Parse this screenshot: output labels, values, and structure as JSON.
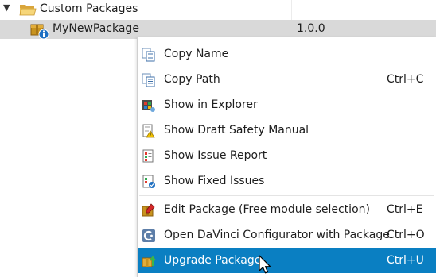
{
  "tree": {
    "parent": {
      "label": "Custom Packages",
      "expanded": true
    },
    "child": {
      "label": "MyNewPackage",
      "version": "1.0.0"
    }
  },
  "context_menu": {
    "items": [
      {
        "label": "Copy Name",
        "shortcut": "",
        "icon": "copy-name-icon"
      },
      {
        "label": "Copy Path",
        "shortcut": "Ctrl+C",
        "icon": "copy-path-icon"
      },
      {
        "label": "Show in Explorer",
        "shortcut": "",
        "icon": "explorer-icon"
      },
      {
        "label": "Show Draft Safety Manual",
        "shortcut": "",
        "icon": "safety-manual-icon"
      },
      {
        "label": "Show Issue Report",
        "shortcut": "",
        "icon": "issue-report-icon"
      },
      {
        "label": "Show Fixed Issues",
        "shortcut": "",
        "icon": "fixed-issues-icon"
      },
      {
        "label": "Edit Package (Free module selection)",
        "shortcut": "Ctrl+E",
        "icon": "edit-package-icon"
      },
      {
        "label": "Open DaVinci Configurator with Package",
        "shortcut": "Ctrl+O",
        "icon": "davinci-configurator-icon"
      },
      {
        "label": "Upgrade Package",
        "shortcut": "Ctrl+U",
        "icon": "upgrade-package-icon",
        "selected": true
      }
    ]
  },
  "colors": {
    "selection": "#0a7fc2",
    "row_highlight": "#d9d9d9"
  }
}
